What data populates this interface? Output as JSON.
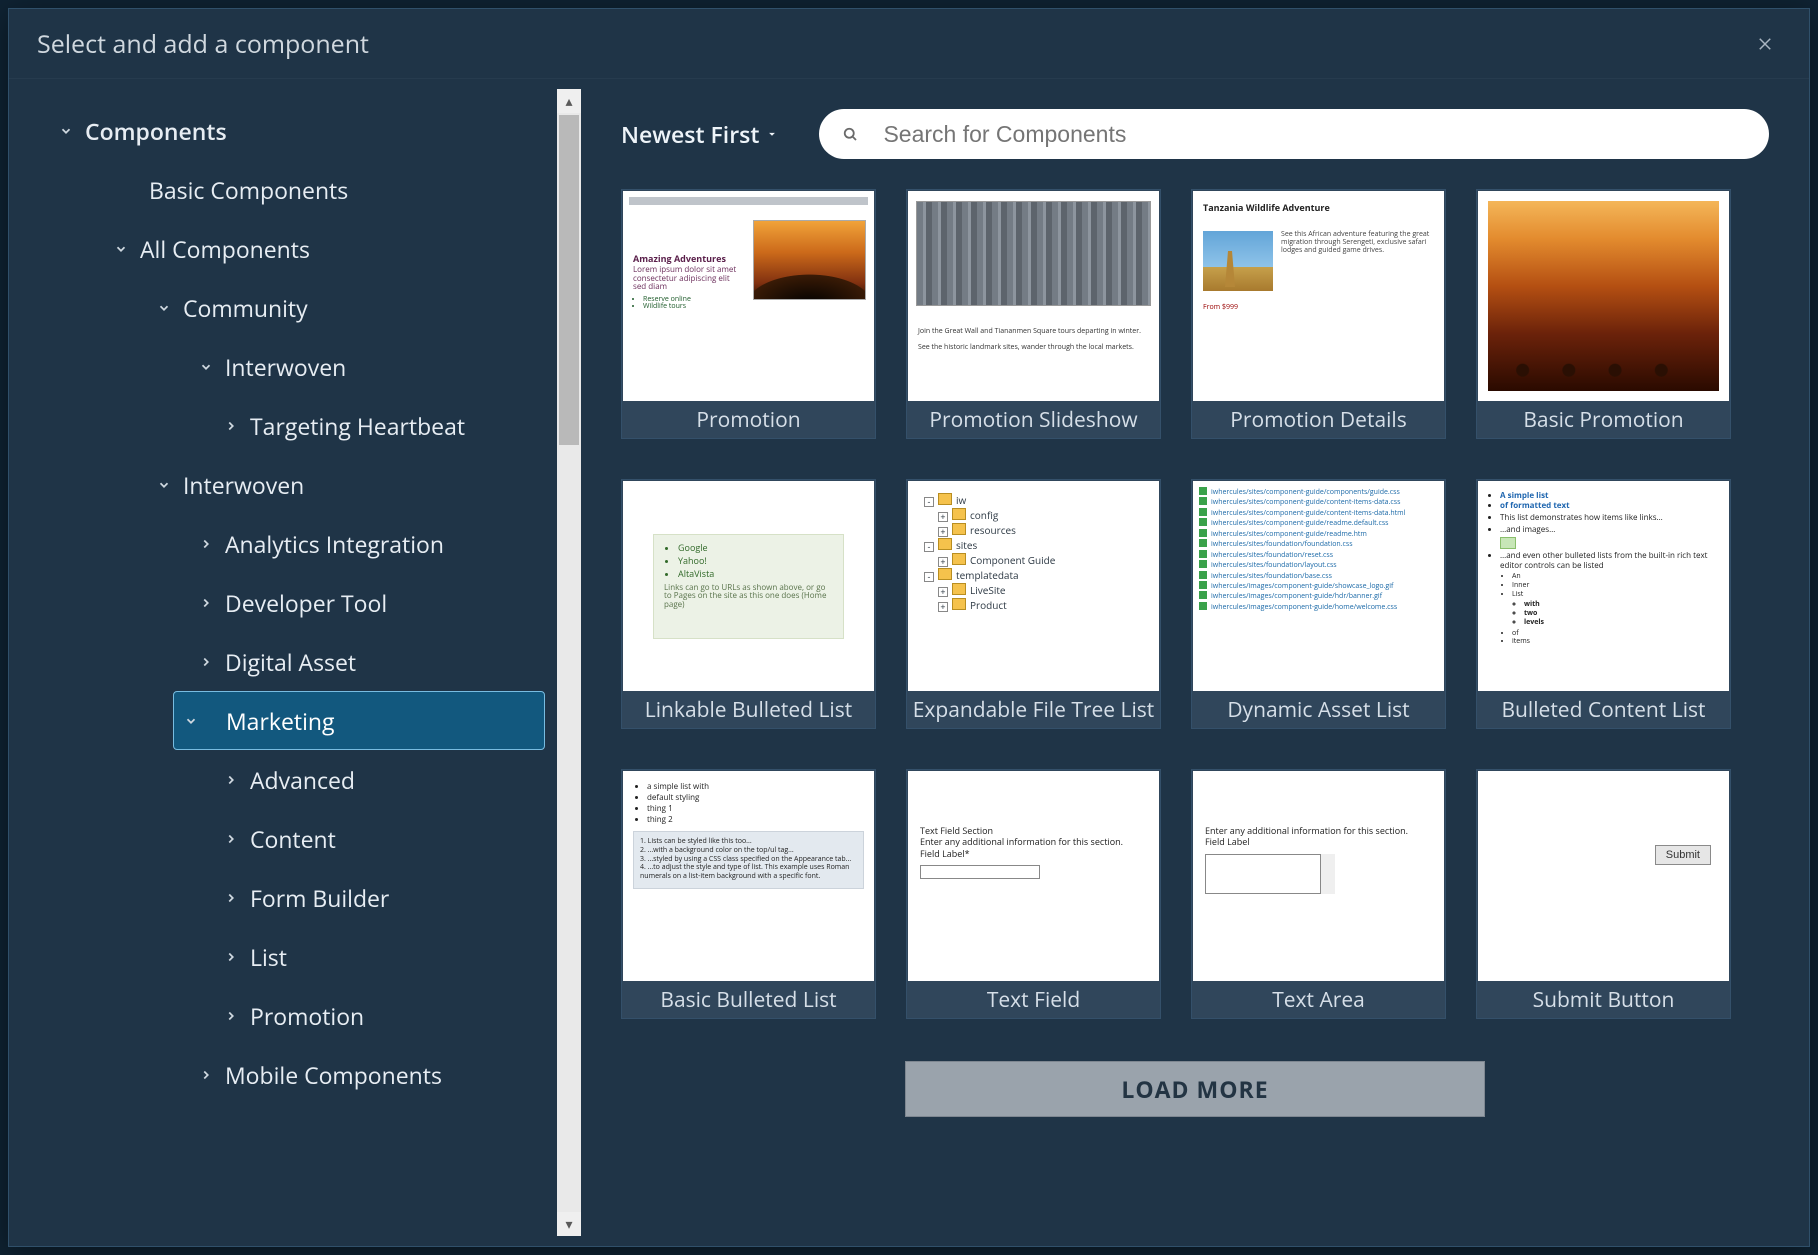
{
  "header": {
    "title": "Select and add a component"
  },
  "tree": {
    "root": "Components",
    "basic": "Basic Components",
    "all": "All Components",
    "community": "Community",
    "interwoven1": "Interwoven",
    "targeting": "Targeting Heartbeat",
    "interwoven2": "Interwoven",
    "analytics": "Analytics Integration",
    "devtool": "Developer Tool",
    "digital": "Digital Asset",
    "marketing": "Marketing",
    "advanced": "Advanced",
    "content": "Content",
    "form": "Form Builder",
    "list": "List",
    "promotion": "Promotion",
    "mobile": "Mobile Components"
  },
  "toolbar": {
    "sort": "Newest First",
    "search_placeholder": "Search for Components"
  },
  "cards": [
    {
      "label": "Promotion"
    },
    {
      "label": "Promotion Slideshow"
    },
    {
      "label": "Promotion Details"
    },
    {
      "label": "Basic Promotion"
    },
    {
      "label": "Linkable Bulleted List"
    },
    {
      "label": "Expandable File Tree List"
    },
    {
      "label": "Dynamic Asset List"
    },
    {
      "label": "Bulleted Content List"
    },
    {
      "label": "Basic Bulleted List"
    },
    {
      "label": "Text Field"
    },
    {
      "label": "Text Area"
    },
    {
      "label": "Submit Button"
    }
  ],
  "load_more": "LOAD MORE",
  "thumb_text": {
    "promo_head": "Amazing Adventures",
    "details_title": "Tanzania Wildlife Adventure",
    "link_items": [
      "Google",
      "Yahoo!",
      "AltaVista"
    ],
    "link_note": "Links can go to URLs as shown above, or go to Pages on the site as this one does (Home page)",
    "tree_items": [
      "iw",
      "config",
      "resources",
      "sites",
      "Component Guide",
      "templatedata",
      "LiveSite",
      "Product"
    ],
    "tf_section": "Text Field Section",
    "tf_prompt": "Enter any additional information for this section.",
    "tf_label": "Field Label*",
    "ta_prompt": "Enter any additional information for this section.",
    "ta_label": "Field Label",
    "submit": "Submit",
    "bcl_h1": "A simple list",
    "bcl_h2": "of formatted text"
  }
}
